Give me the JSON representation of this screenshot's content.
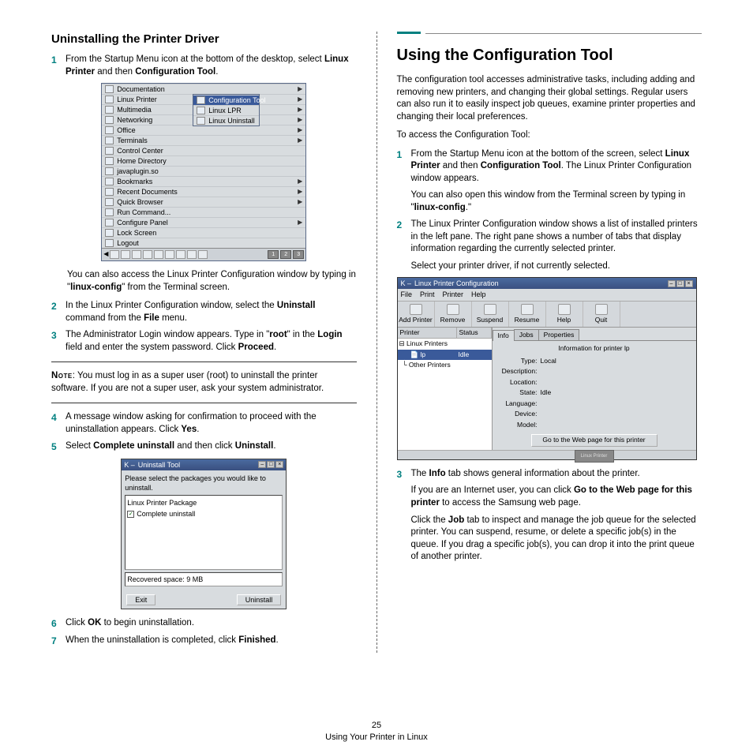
{
  "left": {
    "heading": "Uninstalling the Printer Driver",
    "step1_pre": "From the Startup Menu icon at the bottom of the desktop, select ",
    "step1_b1": "Linux Printer",
    "step1_mid": " and then ",
    "step1_b2": "Configuration Tool",
    "step1_end": ".",
    "after_shot1": "You can also access the Linux Printer Configuration window by typing in \"",
    "after_shot1_b": "linux-config",
    "after_shot1_end": "\" from the Terminal screen.",
    "step2_pre": "In the Linux Printer Configuration window, select the ",
    "step2_b1": "Uninstall",
    "step2_mid": " command from the ",
    "step2_b2": "File",
    "step2_end": " menu.",
    "step3_pre": "The Administrator Login window appears. Type in \"",
    "step3_b1": "root",
    "step3_mid": "\" in the ",
    "step3_b2": "Login",
    "step3_mid2": " field and enter the system password. Click ",
    "step3_b3": "Proceed",
    "step3_end": ".",
    "note_label": "Note",
    "note_text": ": You must log in as a super user (root) to uninstall the printer software. If you are not a super user, ask your system administrator.",
    "step4_pre": "A message window asking for confirmation to proceed with the uninstallation appears. Click ",
    "step4_b": "Yes",
    "step4_end": ".",
    "step5_pre": "Select ",
    "step5_b1": "Complete uninstall",
    "step5_mid": " and then click ",
    "step5_b2": "Uninstall",
    "step5_end": ".",
    "step6_pre": "Click ",
    "step6_b": "OK",
    "step6_end": " to begin uninstallation.",
    "step7_pre": "When the uninstallation is completed, click ",
    "step7_b": "Finished",
    "step7_end": "."
  },
  "shot_menu": {
    "items": [
      "Documentation",
      "Linux Printer",
      "Multimedia",
      "Networking",
      "Office",
      "Terminals",
      "Control Center",
      "Home Directory",
      "javaplugin.so",
      "Bookmarks",
      "Recent Documents",
      "Quick Browser",
      "Run Command...",
      "Configure Panel",
      "Lock Screen",
      "Logout"
    ],
    "arrows": [
      true,
      true,
      true,
      true,
      true,
      true,
      false,
      false,
      false,
      true,
      true,
      true,
      false,
      true,
      false,
      false
    ],
    "submenu": [
      "Configuration Tool",
      "Linux LPR",
      "Linux Uninstall"
    ],
    "task_nums": [
      "1",
      "2",
      "3"
    ]
  },
  "shot_uninstall": {
    "title": "Uninstall Tool",
    "prompt": "Please select the packages you would like to uninstall.",
    "item1": "Linux Printer Package",
    "item2": "Complete uninstall",
    "recovered": "Recovered space: 9 MB",
    "exit": "Exit",
    "uninstall": "Uninstall"
  },
  "right": {
    "heading": "Using the Configuration Tool",
    "intro": "The configuration tool accesses administrative tasks, including adding and removing new printers, and changing their global settings. Regular users can also run it to easily inspect job queues, examine printer properties and changing their local preferences.",
    "access": "To access the Configuration Tool:",
    "step1_pre": "From the Startup Menu icon at the bottom of the screen, select ",
    "step1_b1": "Linux Printer",
    "step1_mid": " and then ",
    "step1_b2": "Configuration Tool",
    "step1_end": ". The Linux Printer Configuration window appears.",
    "step1_extra_pre": "You can also open this window from the Terminal screen by typing in \"",
    "step1_extra_b": "linux-config",
    "step1_extra_end": ".\"",
    "step2": "The Linux Printer Configuration window shows a list of installed printers in the left pane. The right pane shows a number of tabs that display information regarding the currently selected printer.",
    "step2_extra": "Select your printer driver, if not currently selected.",
    "step3_pre": "The ",
    "step3_b1": "Info",
    "step3_mid": " tab shows general information about the printer.",
    "step3_p2_pre": "If you are an Internet user, you can click ",
    "step3_p2_b": "Go to the Web page for this printer",
    "step3_p2_end": " to access the Samsung web page.",
    "step3_p3_pre": "Click the ",
    "step3_p3_b": "Job",
    "step3_p3_end": " tab to inspect and manage the job queue for the selected printer. You can suspend, resume, or delete a specific job(s) in the queue. If you drag a specific job(s), you can drop it into the print queue of another printer."
  },
  "shot_config": {
    "title": "Linux Printer Configuration",
    "menus": [
      "File",
      "Print",
      "Printer",
      "Help"
    ],
    "tools": [
      "Add Printer",
      "Remove",
      "Suspend",
      "Resume",
      "Help",
      "Quit"
    ],
    "tree_h1": "Printer",
    "tree_h2": "Status",
    "tree_root": "Linux Printers",
    "tree_sel": "lp",
    "tree_sel_status": "Idle",
    "tree_other": "Other Printers",
    "tabs": [
      "Info",
      "Jobs",
      "Properties"
    ],
    "info_title": "Information for printer lp",
    "fields": [
      "Type:",
      "Description:",
      "Location:",
      "State:",
      "Language:",
      "Device:",
      "Model:"
    ],
    "type_val": "Local",
    "state_val": "Idle",
    "webbtn": "Go to the Web page for this printer",
    "logo": "Linux Printer"
  },
  "footer": {
    "page": "25",
    "chapter": "Using Your Printer in Linux"
  }
}
